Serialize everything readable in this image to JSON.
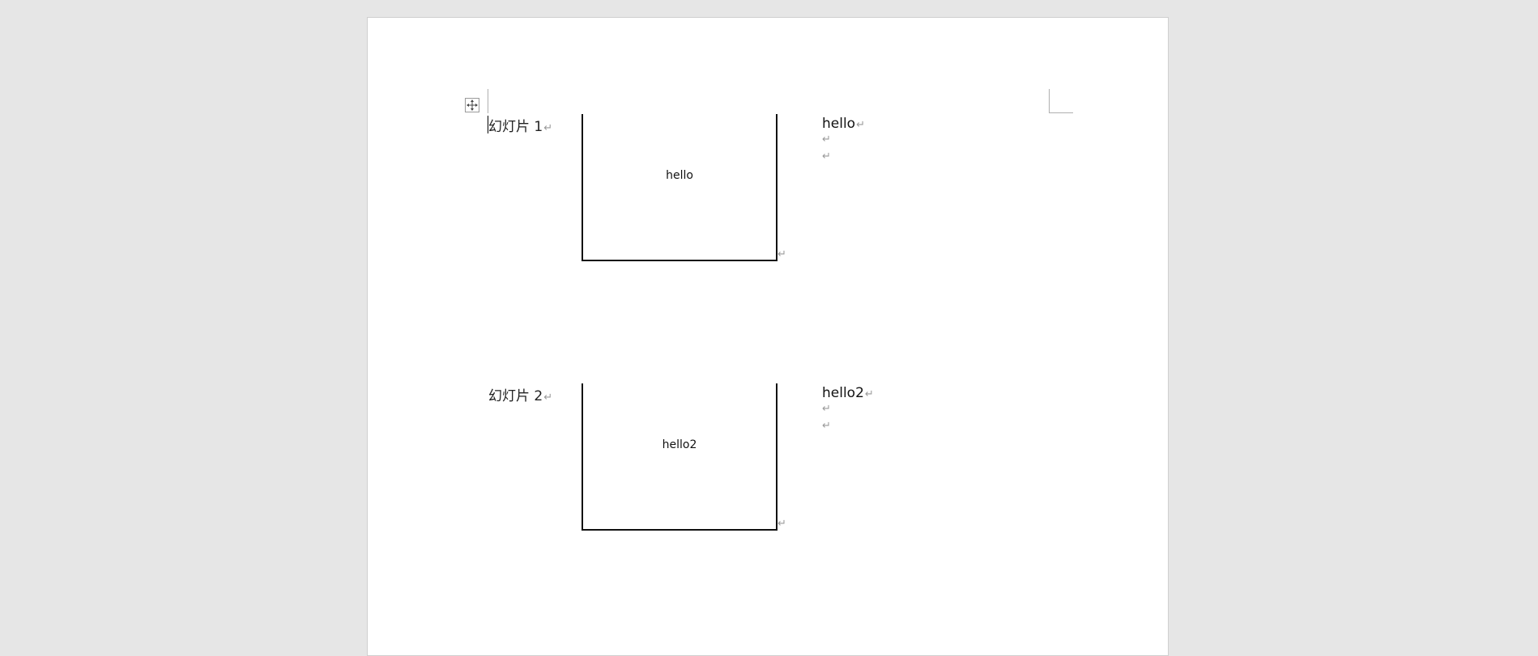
{
  "document": {
    "para_mark": "↵",
    "slides": [
      {
        "label": "幻灯片 1",
        "thumbnail_text": "hello",
        "notes": [
          "hello",
          "",
          ""
        ]
      },
      {
        "label": "幻灯片 2",
        "thumbnail_text": "hello2",
        "notes": [
          "hello2",
          "",
          ""
        ]
      }
    ]
  },
  "icons": {
    "table_move_handle": "move-arrows-icon"
  },
  "colors": {
    "workspace_bg": "#e6e6e6",
    "page_bg": "#ffffff",
    "para_mark": "#9a9a9a"
  }
}
